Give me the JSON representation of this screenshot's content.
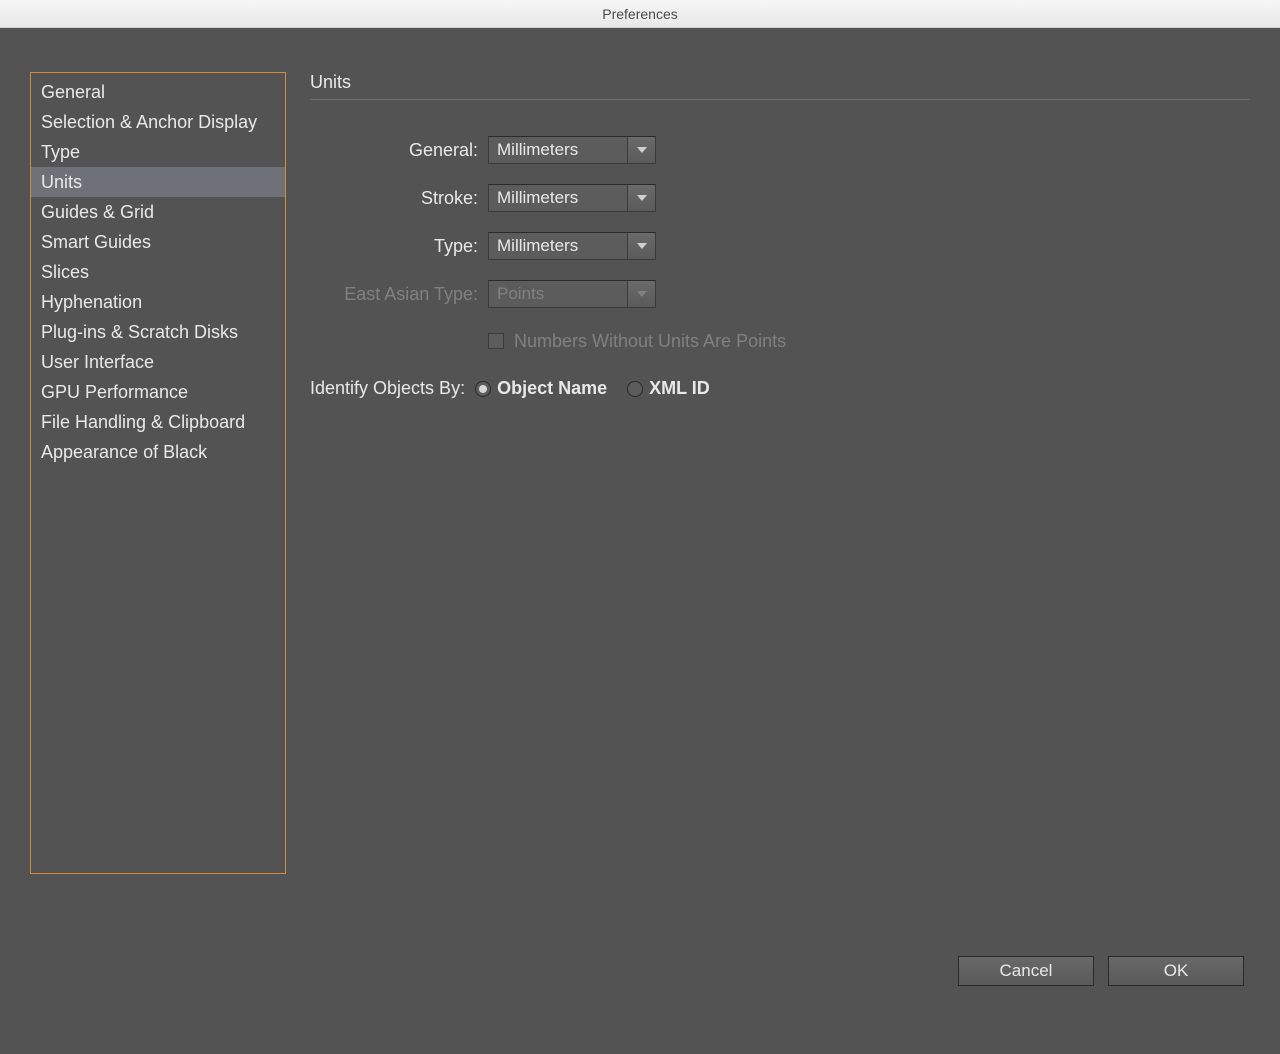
{
  "titlebar": {
    "title": "Preferences"
  },
  "sidebar": {
    "items": [
      {
        "label": "General",
        "selected": false
      },
      {
        "label": "Selection & Anchor Display",
        "selected": false
      },
      {
        "label": "Type",
        "selected": false
      },
      {
        "label": "Units",
        "selected": true
      },
      {
        "label": "Guides & Grid",
        "selected": false
      },
      {
        "label": "Smart Guides",
        "selected": false
      },
      {
        "label": "Slices",
        "selected": false
      },
      {
        "label": "Hyphenation",
        "selected": false
      },
      {
        "label": "Plug-ins & Scratch Disks",
        "selected": false
      },
      {
        "label": "User Interface",
        "selected": false
      },
      {
        "label": "GPU Performance",
        "selected": false
      },
      {
        "label": "File Handling & Clipboard",
        "selected": false
      },
      {
        "label": "Appearance of Black",
        "selected": false
      }
    ]
  },
  "panel": {
    "title": "Units",
    "labels": {
      "general": "General:",
      "stroke": "Stroke:",
      "type": "Type:",
      "east_asian": "East Asian Type:",
      "numbers_without_units": "Numbers Without Units Are Points",
      "identify_by": "Identify Objects By:",
      "object_name": "Object Name",
      "xml_id": "XML ID"
    },
    "values": {
      "general": "Millimeters",
      "stroke": "Millimeters",
      "type": "Millimeters",
      "east_asian": "Points",
      "numbers_without_units_checked": false,
      "identify_by_selected": "object_name"
    }
  },
  "buttons": {
    "cancel": "Cancel",
    "ok": "OK"
  }
}
